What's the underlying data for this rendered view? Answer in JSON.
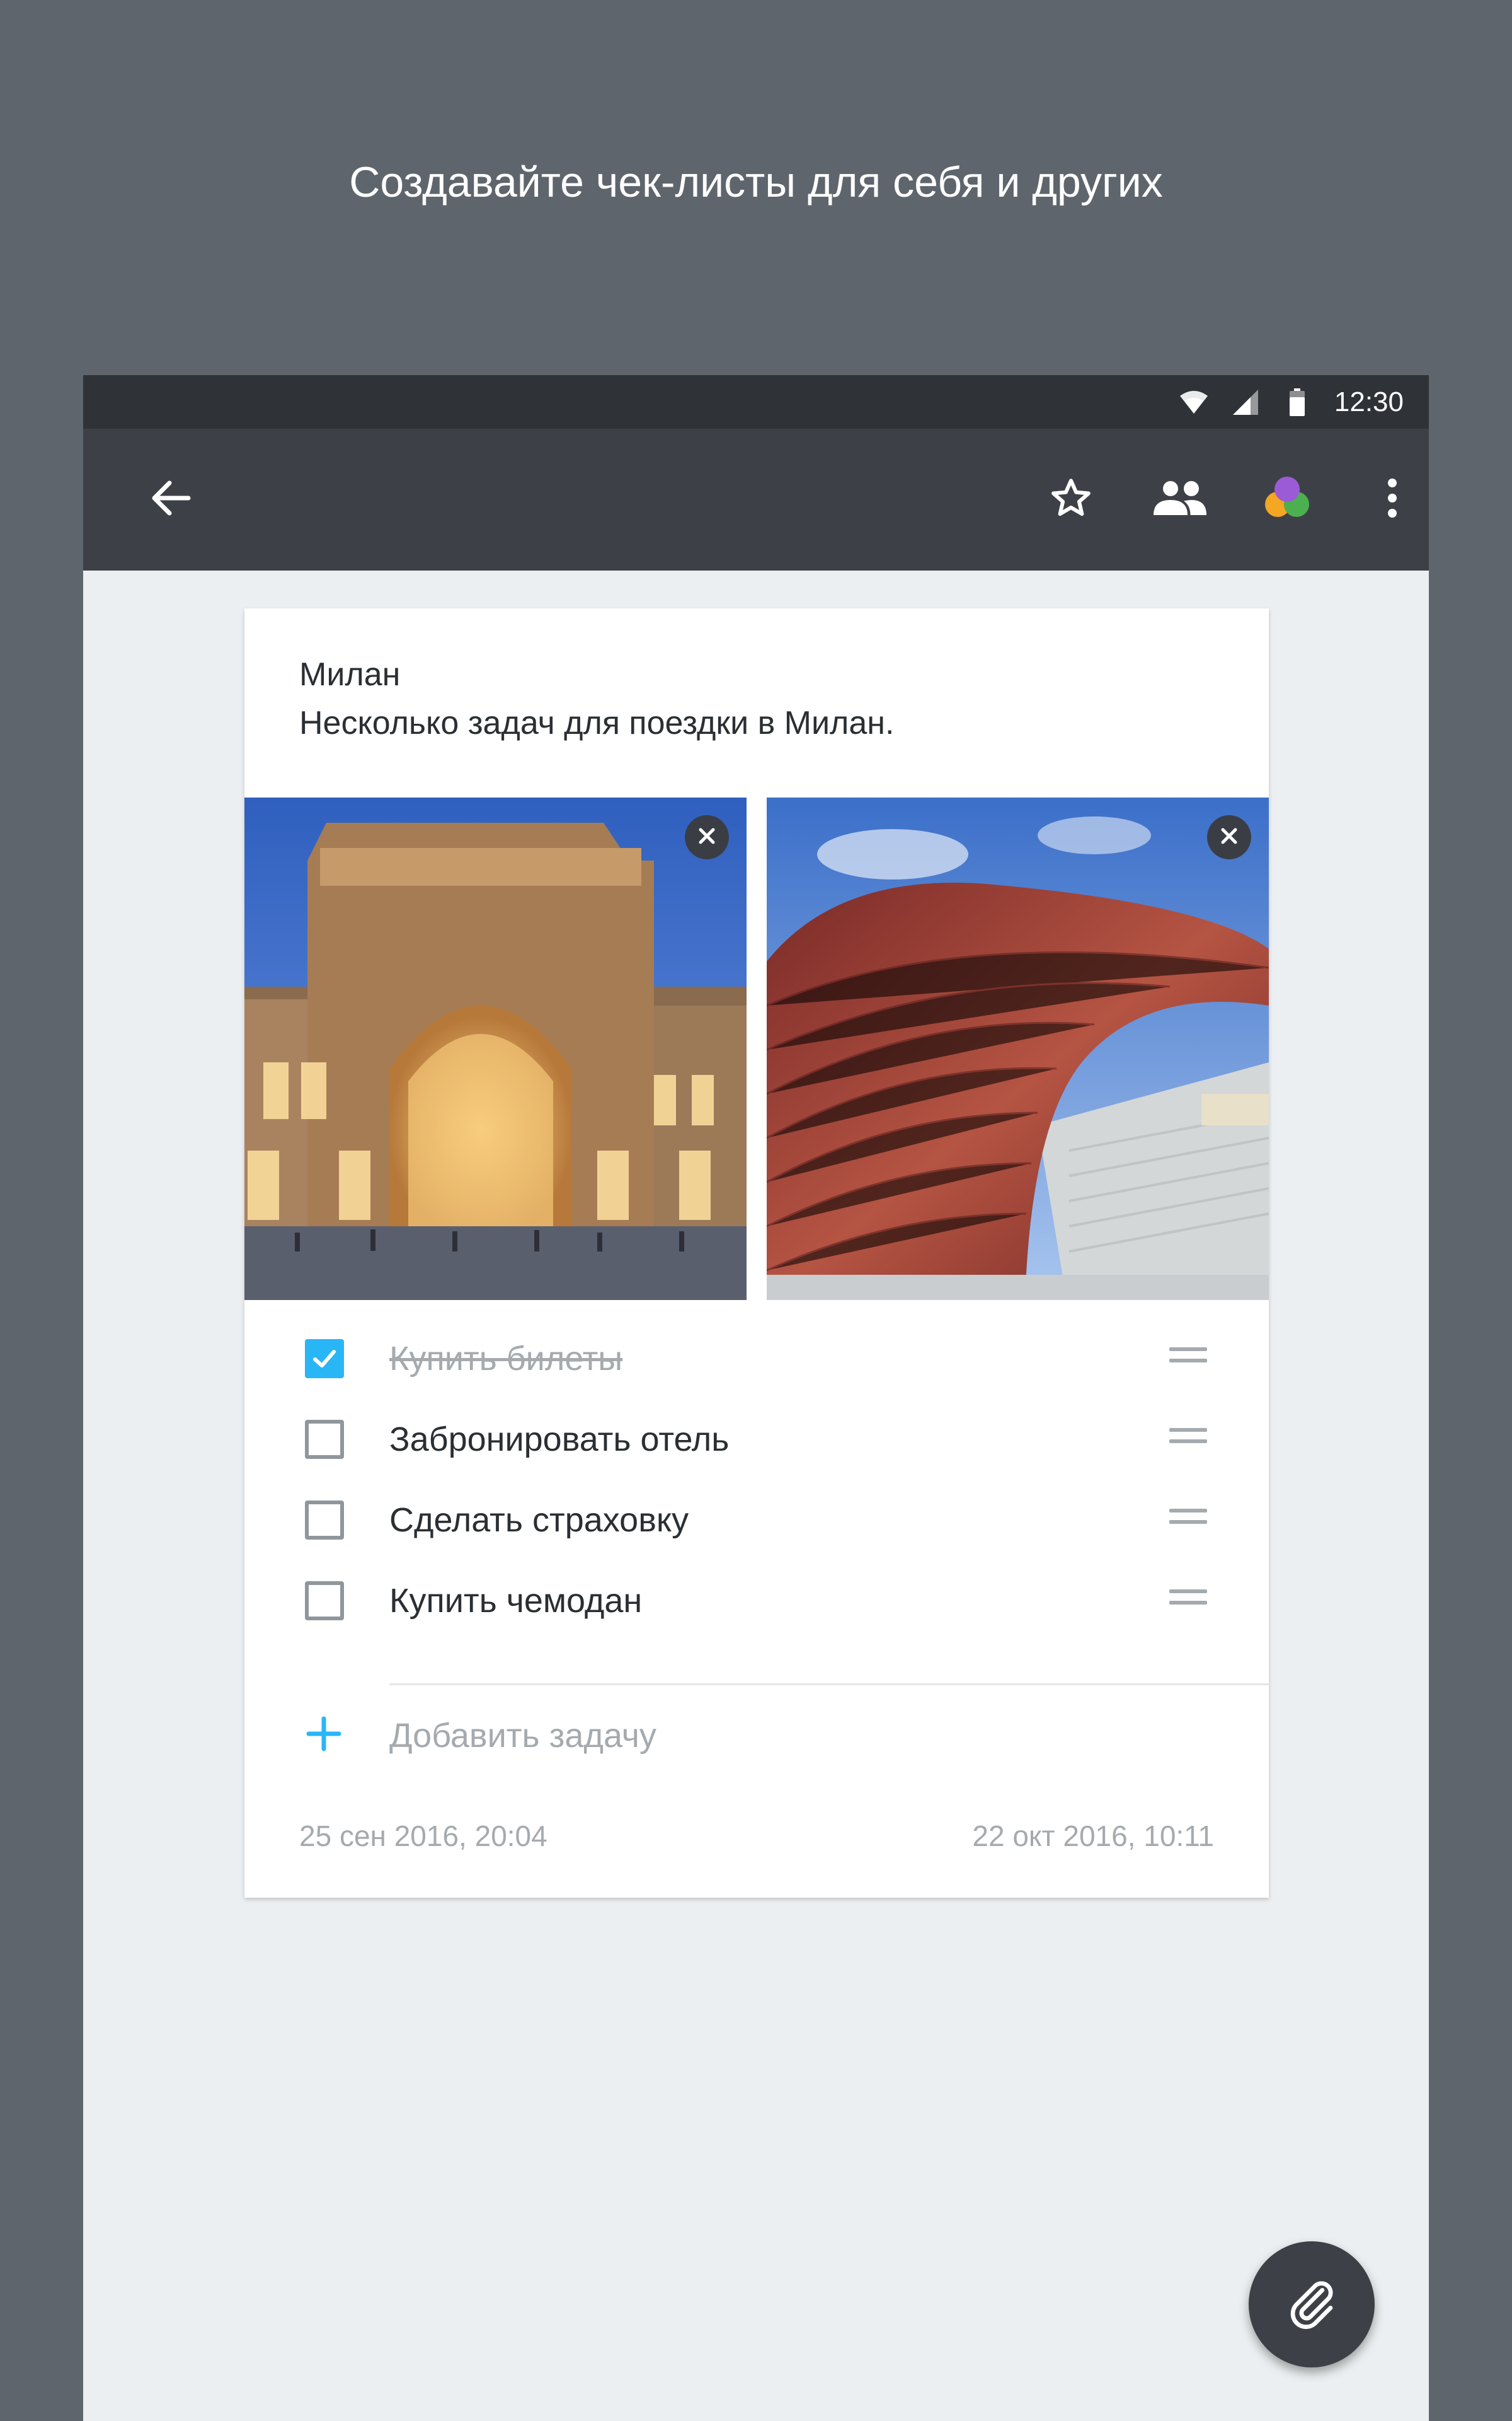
{
  "promo": {
    "title": "Создавайте чек-листы для себя и других"
  },
  "status_bar": {
    "time": "12:30",
    "icons": [
      "wifi-icon",
      "cellular-icon",
      "battery-icon"
    ]
  },
  "app_bar": {
    "back_icon": "arrow-back-icon",
    "actions": [
      "star-outline-icon",
      "people-icon",
      "color-palette-icon",
      "more-vert-icon"
    ]
  },
  "note": {
    "title": "Милан",
    "description": "Несколько задач для поездки в Милан.",
    "photos": [
      {
        "subject": "Galleria Vittorio Emanuele II, Milan"
      },
      {
        "subject": "Vanke Pavilion, Expo Milano"
      }
    ],
    "tasks": [
      {
        "label": "Купить билеты",
        "checked": true
      },
      {
        "label": "Забронировать отель",
        "checked": false
      },
      {
        "label": "Сделать страховку",
        "checked": false
      },
      {
        "label": "Купить чемодан",
        "checked": false
      }
    ],
    "add_task_label": "Добавить задачу",
    "created": "25 сен 2016, 20:04",
    "modified": "22 окт 2016, 10:11"
  },
  "fab": {
    "icon": "attachment-icon"
  },
  "colors": {
    "accent": "#29b6f6",
    "app_bar": "#3d4147",
    "status_bar": "#2f3237",
    "background": "#5f656c"
  }
}
